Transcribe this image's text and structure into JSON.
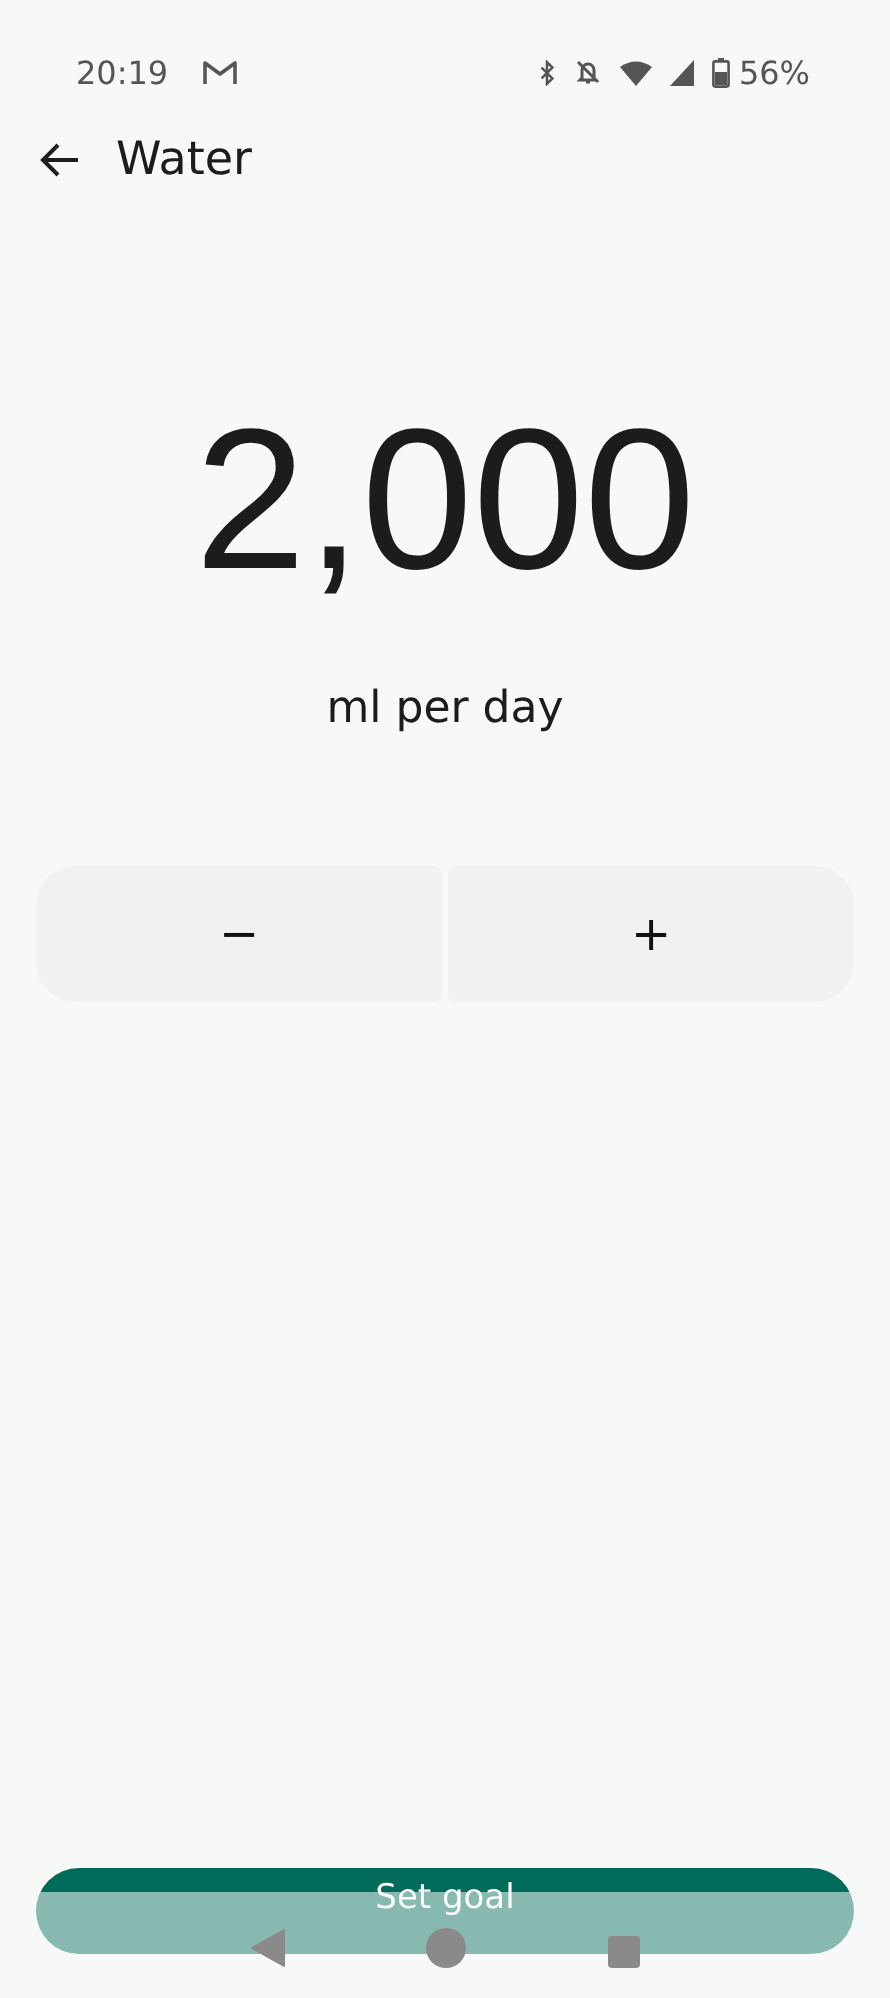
{
  "status_bar": {
    "time": "20:19",
    "battery": "56%"
  },
  "header": {
    "title": "Water"
  },
  "goal": {
    "value": "2,000",
    "unit": "ml per day"
  },
  "stepper": [
    {
      "kind": "decrease",
      "label": "−"
    },
    {
      "kind": "increase",
      "label": "+"
    }
  ],
  "primary_button": {
    "label": "Set goal"
  }
}
